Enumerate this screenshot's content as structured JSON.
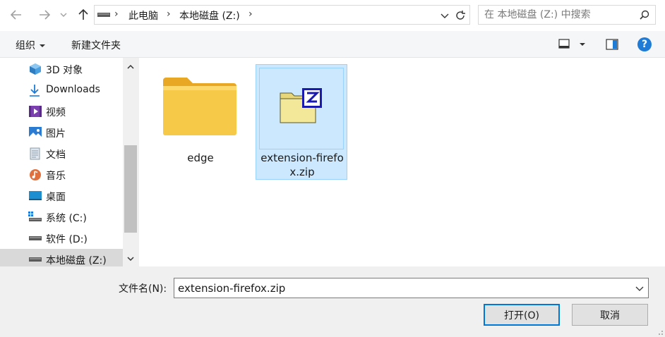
{
  "address": {
    "crumbs": [
      "此电脑",
      "本地磁盘 (Z:)"
    ],
    "search_placeholder": "在 本地磁盘 (Z:) 中搜索"
  },
  "toolbar": {
    "organize_label": "组织",
    "new_folder_label": "新建文件夹",
    "help_label": "?"
  },
  "sidebar": {
    "items": [
      {
        "label": "3D 对象",
        "icon": "3d-objects-icon"
      },
      {
        "label": "Downloads",
        "icon": "downloads-icon"
      },
      {
        "label": "视频",
        "icon": "videos-icon"
      },
      {
        "label": "图片",
        "icon": "pictures-icon"
      },
      {
        "label": "文档",
        "icon": "documents-icon"
      },
      {
        "label": "音乐",
        "icon": "music-icon"
      },
      {
        "label": "桌面",
        "icon": "desktop-icon"
      },
      {
        "label": "系统 (C:)",
        "icon": "system-drive-icon"
      },
      {
        "label": "软件 (D:)",
        "icon": "drive-icon"
      },
      {
        "label": "本地磁盘 (Z:)",
        "icon": "drive-icon",
        "selected": true
      }
    ]
  },
  "files": [
    {
      "name": "edge",
      "type": "folder"
    },
    {
      "name": "extension-firefox.zip",
      "line1": "extension-firefo",
      "line2": "x.zip",
      "type": "zip",
      "selected": true
    }
  ],
  "bottom": {
    "filename_label": "文件名(N):",
    "filename_value": "extension-firefox.zip",
    "open_label": "打开(O)",
    "cancel_label": "取消"
  },
  "colors": {
    "accent": "#0078d7",
    "selection": "#cce8ff",
    "help": "#1e7bd6"
  }
}
